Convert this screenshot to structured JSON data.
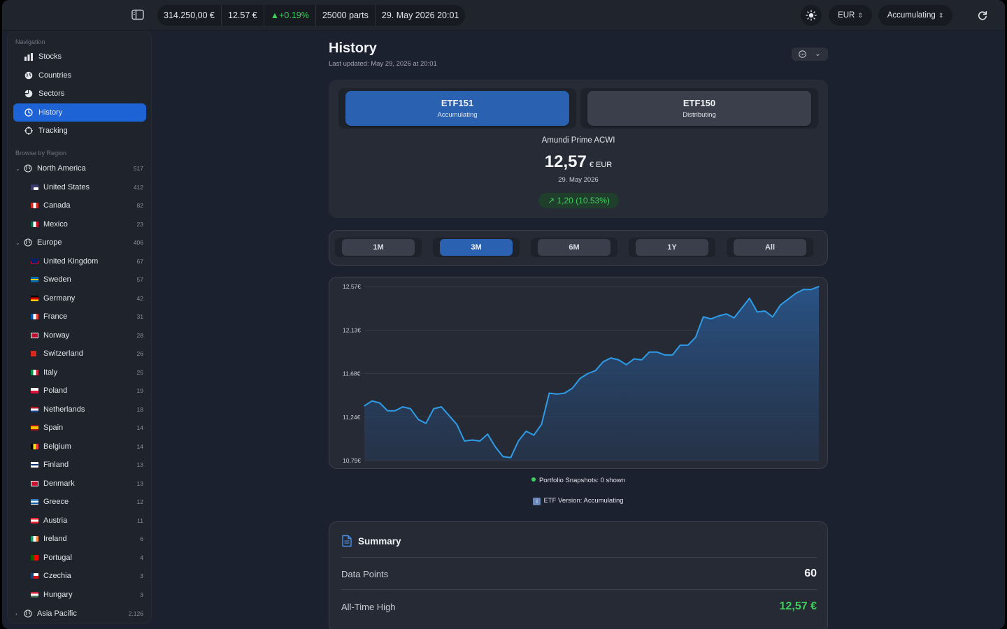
{
  "toolbar": {
    "portfolio_value": "314.250,00 €",
    "price": "12.57 €",
    "change": "▲+0.19%",
    "parts": "25000 parts",
    "datetime": "29. May 2026 20:01",
    "currency": "EUR",
    "version": "Accumulating"
  },
  "sidebar": {
    "nav_label": "Navigation",
    "nav": [
      {
        "label": "Stocks",
        "icon": "bar-chart-icon"
      },
      {
        "label": "Countries",
        "icon": "globe-icon"
      },
      {
        "label": "Sectors",
        "icon": "pie-chart-icon"
      },
      {
        "label": "History",
        "icon": "clock-icon"
      },
      {
        "label": "Tracking",
        "icon": "target-icon"
      }
    ],
    "browse_label": "Browse by Region",
    "regions": {
      "north_america": {
        "label": "North America",
        "count": "517"
      },
      "europe": {
        "label": "Europe",
        "count": "406"
      },
      "asia_pacific": {
        "label": "Asia Pacific",
        "count": "2.126"
      }
    },
    "na_countries": [
      {
        "label": "United States",
        "count": "412"
      },
      {
        "label": "Canada",
        "count": "82"
      },
      {
        "label": "Mexico",
        "count": "23"
      }
    ],
    "eu_countries": [
      {
        "label": "United Kingdom",
        "count": "67"
      },
      {
        "label": "Sweden",
        "count": "57"
      },
      {
        "label": "Germany",
        "count": "42"
      },
      {
        "label": "France",
        "count": "31"
      },
      {
        "label": "Norway",
        "count": "28"
      },
      {
        "label": "Switzerland",
        "count": "26"
      },
      {
        "label": "Italy",
        "count": "25"
      },
      {
        "label": "Poland",
        "count": "19"
      },
      {
        "label": "Netherlands",
        "count": "18"
      },
      {
        "label": "Spain",
        "count": "14"
      },
      {
        "label": "Belgium",
        "count": "14"
      },
      {
        "label": "Finland",
        "count": "13"
      },
      {
        "label": "Denmark",
        "count": "13"
      },
      {
        "label": "Greece",
        "count": "12"
      },
      {
        "label": "Austria",
        "count": "11"
      },
      {
        "label": "Ireland",
        "count": "6"
      },
      {
        "label": "Portugal",
        "count": "4"
      },
      {
        "label": "Czechia",
        "count": "3"
      },
      {
        "label": "Hungary",
        "count": "3"
      }
    ]
  },
  "main": {
    "title": "History",
    "last_updated": "Last updated: May 29, 2026 at 20:01",
    "etf_tabs": [
      {
        "name": "ETF151",
        "kind": "Accumulating"
      },
      {
        "name": "ETF150",
        "kind": "Distributing"
      }
    ],
    "fund_name": "Amundi Prime ACWI",
    "price_big": "12,57",
    "price_unit": "€ EUR",
    "price_date": "29. May 2026",
    "price_change": "↗ 1,20 (10.53%)",
    "ranges": [
      "1M",
      "3M",
      "6M",
      "1Y",
      "All"
    ],
    "legend_snapshots": "Portfolio Snapshots: 0 shown",
    "legend_version": "ETF Version: Accumulating",
    "summary": {
      "title": "Summary",
      "rows": [
        {
          "label": "Data Points",
          "value": "60"
        },
        {
          "label": "All-Time High",
          "value": "12,57 €"
        }
      ]
    }
  },
  "colors": {
    "accent_blue": "#1e63d6",
    "selected_tab": "#2a61b0",
    "positive_green": "#3fcf5c",
    "chart_line": "#2f9be6"
  },
  "chart_data": {
    "type": "area",
    "y_ticks": [
      "12,57€",
      "12,13€",
      "11,68€",
      "11,24€",
      "10,79€"
    ],
    "ylim": [
      10.79,
      12.57
    ],
    "values": [
      11.35,
      11.4,
      11.38,
      11.3,
      11.3,
      11.34,
      11.32,
      11.21,
      11.17,
      11.32,
      11.34,
      11.25,
      11.16,
      10.99,
      11.0,
      10.99,
      11.06,
      10.93,
      10.83,
      10.82,
      10.99,
      11.09,
      11.05,
      11.16,
      11.48,
      11.47,
      11.48,
      11.53,
      11.63,
      11.68,
      11.71,
      11.8,
      11.84,
      11.82,
      11.77,
      11.83,
      11.82,
      11.9,
      11.9,
      11.87,
      11.87,
      11.97,
      11.97,
      12.05,
      12.26,
      12.24,
      12.27,
      12.29,
      12.25,
      12.35,
      12.45,
      12.31,
      12.32,
      12.26,
      12.38,
      12.44,
      12.5,
      12.54,
      12.54,
      12.57
    ],
    "grid": true
  }
}
